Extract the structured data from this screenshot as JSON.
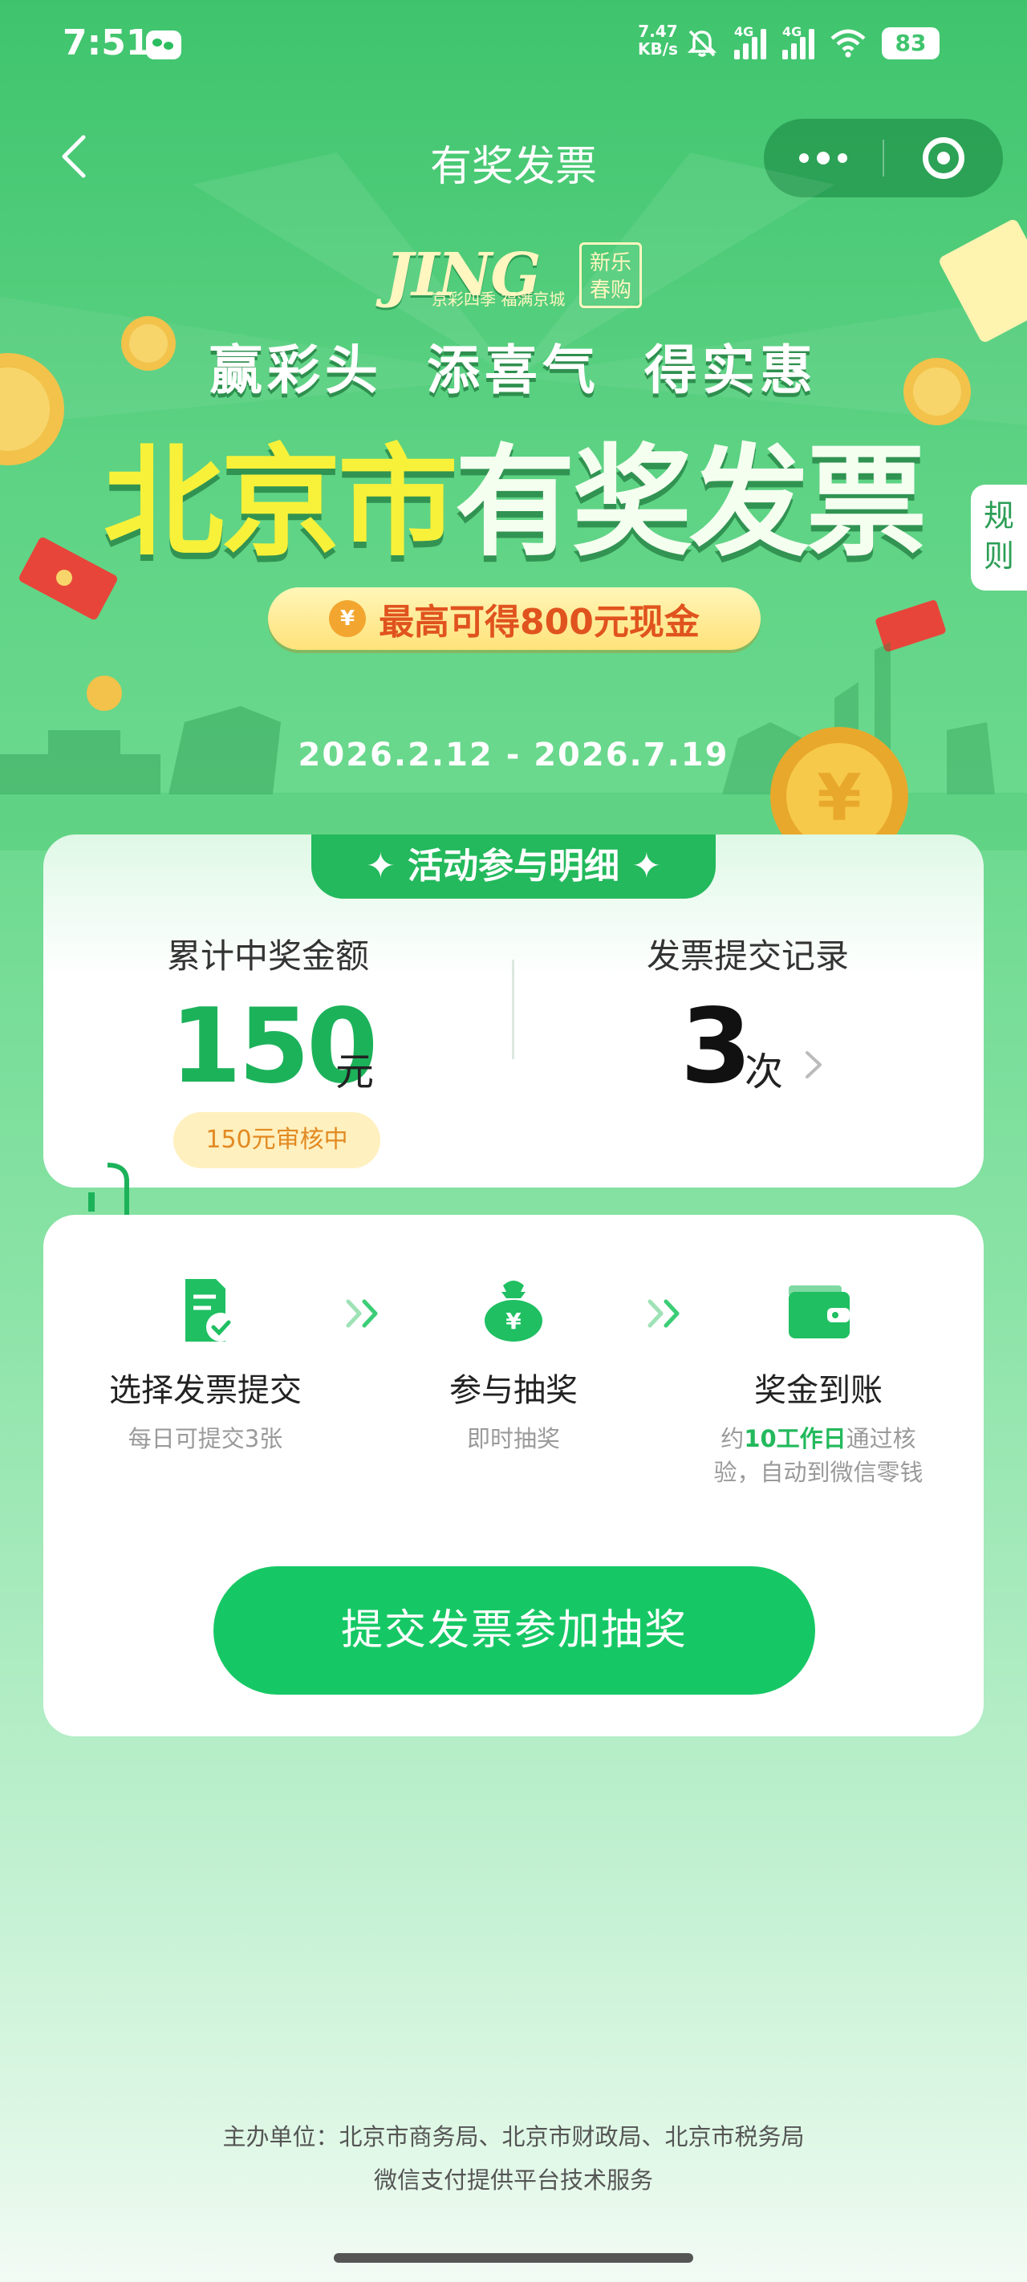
{
  "status_bar": {
    "time": "7:51",
    "net_speed_value": "7.47",
    "net_speed_unit": "KB/s",
    "signal1_tag": "4G",
    "signal2_tag": "4G",
    "battery": "83"
  },
  "nav": {
    "title": "有奖发票"
  },
  "banner": {
    "logo_text": "JING",
    "logo_sub": "京彩四季 福满京城",
    "logo_box": "新乐春购",
    "slogan": "赢彩头 添喜气 得实惠",
    "headline_yellow": "北京市",
    "headline_white": "有奖发票",
    "cash_coin": "¥",
    "cash_text": "最高可得800元现金",
    "dates": "2026.2.12 - 2026.7.19",
    "rules_tab": "规则"
  },
  "details": {
    "tag": "✦ 活动参与明细 ✦",
    "winnings_label": "累计中奖金额",
    "winnings_amount": "150",
    "winnings_unit": "元",
    "review_status": "150元审核中",
    "records_label": "发票提交记录",
    "records_count": "3",
    "records_unit": "次"
  },
  "steps": [
    {
      "title": "选择发票提交",
      "sub": "每日可提交3张",
      "icon": "invoice-check-icon"
    },
    {
      "title": "参与抽奖",
      "sub": "即时抽奖",
      "icon": "money-bag-icon"
    },
    {
      "title": "奖金到账",
      "sub_prefix": "约",
      "sub_highlight": "10工作日",
      "sub_suffix": "通过核验，自动到微信零钱",
      "icon": "wallet-icon"
    }
  ],
  "submit_button": "提交发票参加抽奖",
  "footer": {
    "line1": "主办单位：北京市商务局、北京市财政局、北京市税务局",
    "line2": "微信支付提供平台技术服务"
  },
  "colors": {
    "brand_green": "#16c865",
    "amount_green": "#1cb25a",
    "headline_yellow": "#f8f13a",
    "cash_orange": "#e0531e",
    "review_orange": "#e28a22"
  }
}
